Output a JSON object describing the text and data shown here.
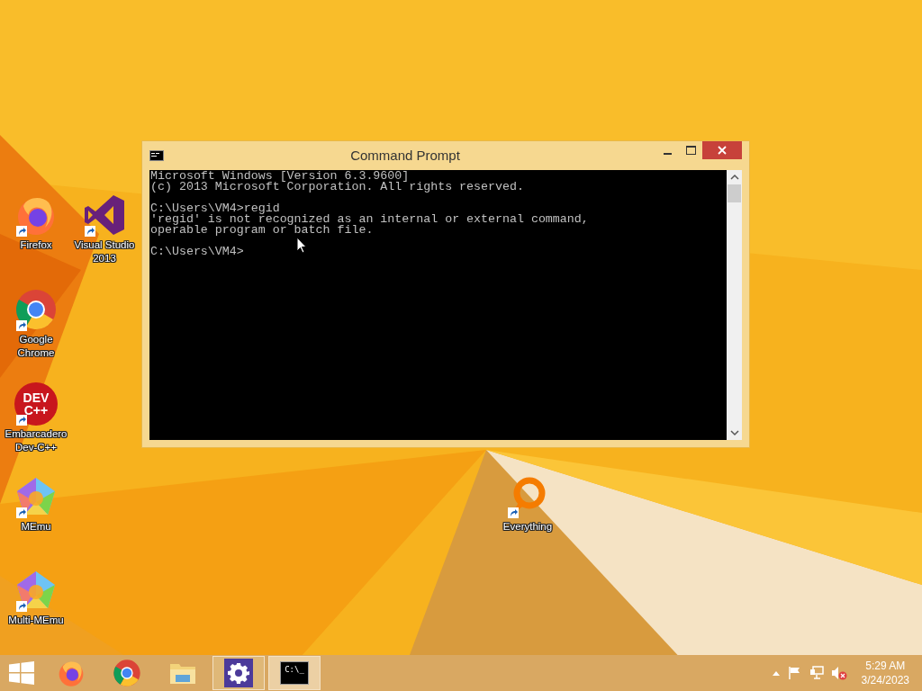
{
  "desktop_icons": [
    {
      "kind": "firefox",
      "label": "Firefox"
    },
    {
      "kind": "visual-studio",
      "label": "Visual Studio 2013"
    },
    {
      "kind": "chrome",
      "label": "Google Chrome"
    },
    {
      "kind": "devcpp",
      "label": "Embarcadero Dev-C++",
      "icon_text": "DEV\nC++"
    },
    {
      "kind": "memu",
      "label": "MEmu"
    },
    {
      "kind": "multi-memu",
      "label": "Multi-MEmu"
    },
    {
      "kind": "everything",
      "label": "Everything"
    }
  ],
  "window": {
    "title": "Command Prompt",
    "console_blocks": [
      [
        "Microsoft Windows [Version 6.3.9600]",
        "(c) 2013 Microsoft Corporation. All rights reserved."
      ],
      [
        "C:\\Users\\VM4>regid",
        "'regid' is not recognized as an internal or external command,",
        "operable program or batch file."
      ],
      [
        "C:\\Users\\VM4>"
      ]
    ]
  },
  "taskbar": {
    "apps": [
      {
        "kind": "firefox",
        "running": false,
        "selected": false
      },
      {
        "kind": "chrome",
        "running": false,
        "selected": false
      },
      {
        "kind": "explorer",
        "running": false,
        "selected": false
      },
      {
        "kind": "settings",
        "running": true,
        "selected": false
      },
      {
        "kind": "cmd",
        "running": true,
        "selected": true,
        "icon_text": "C:\\_"
      }
    ],
    "clock": {
      "time": "5:29 AM",
      "date": "3/24/2023"
    }
  }
}
